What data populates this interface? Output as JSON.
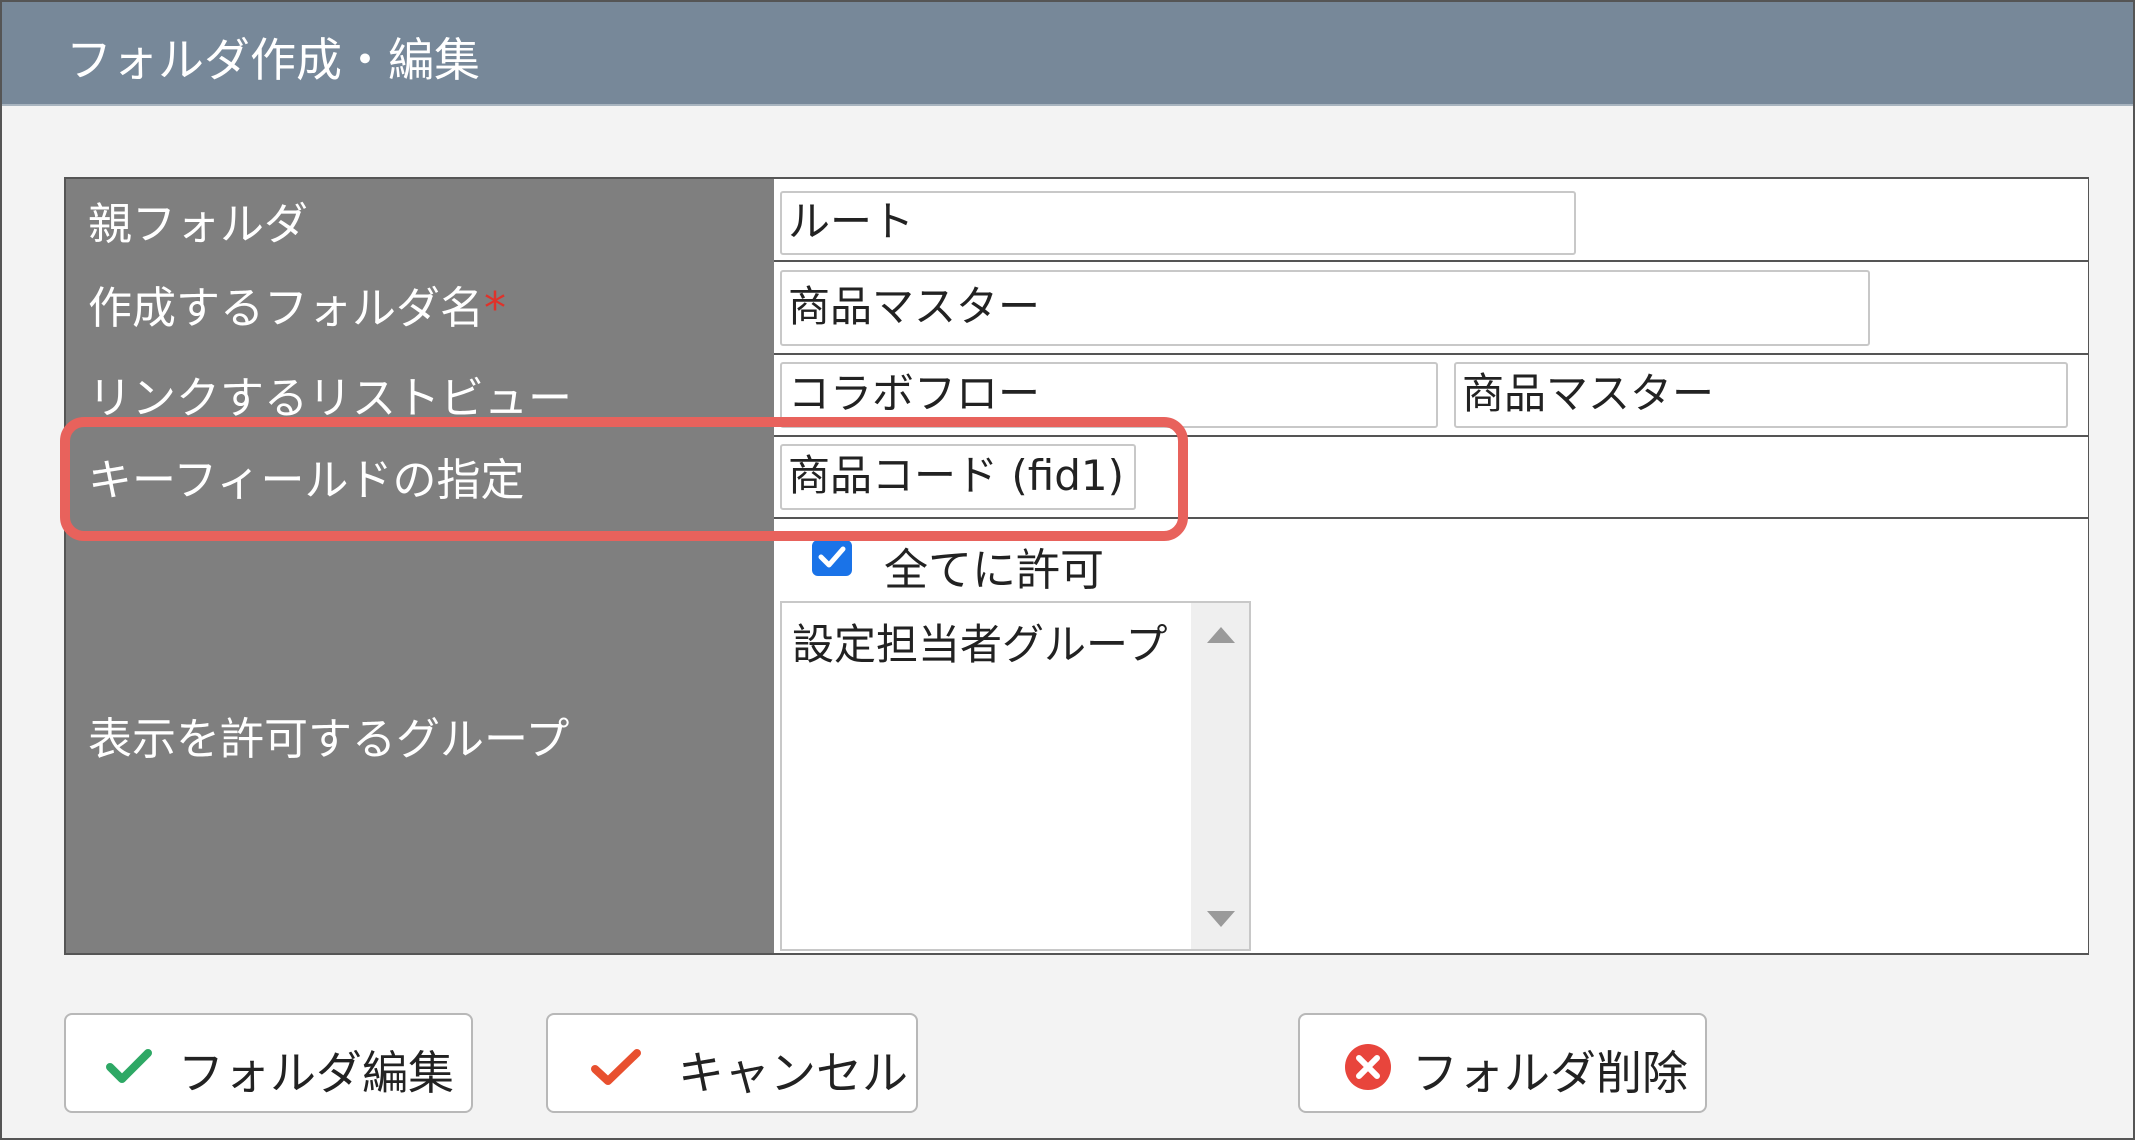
{
  "dialog": {
    "title": "フォルダ作成・編集"
  },
  "form": {
    "parent_folder": {
      "label": "親フォルダ",
      "value": "ルート"
    },
    "folder_name": {
      "label": "作成するフォルダ名",
      "required_mark": "*",
      "value": "商品マスター"
    },
    "linked_list_view": {
      "label": "リンクするリストビュー",
      "app_value": "コラボフロー",
      "view_value": "商品マスター"
    },
    "key_field": {
      "label": "キーフィールドの指定",
      "value": "商品コード (fid1)"
    },
    "allowed_groups": {
      "label": "表示を許可するグループ",
      "allow_all_label": "全てに許可",
      "allow_all_checked": true,
      "options": [
        "設定担当者グループ"
      ]
    }
  },
  "buttons": {
    "edit_folder": "フォルダ編集",
    "cancel": "キャンセル",
    "delete_folder": "フォルダ削除"
  },
  "colors": {
    "title_bar": "#778899",
    "label_bg": "#7f7f7f",
    "highlight": "#e8625c",
    "check_green": "#2ea865",
    "cancel_red": "#e8502f",
    "delete_red": "#e8453c"
  }
}
